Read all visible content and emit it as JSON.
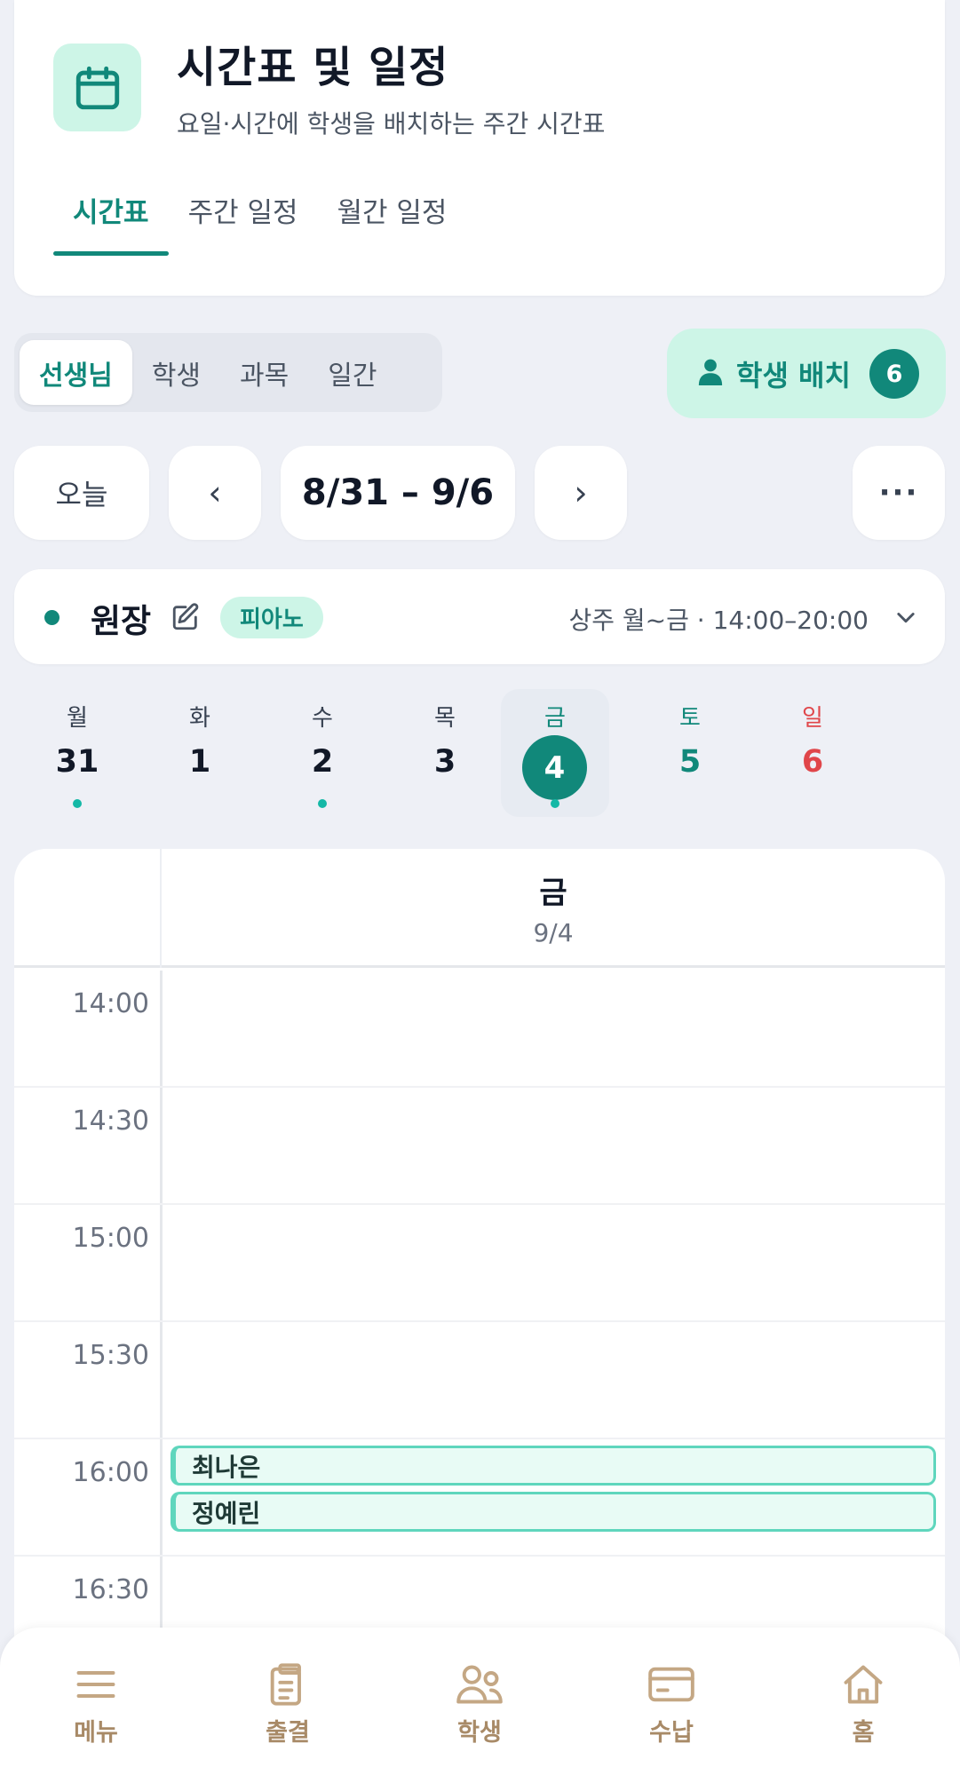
{
  "header": {
    "title": "시간표 및 일정",
    "subtitle": "요일·시간에 학생을 배치하는 주간 시간표",
    "tabs": [
      {
        "label": "시간표"
      },
      {
        "label": "주간 일정"
      },
      {
        "label": "월간 일정"
      }
    ]
  },
  "view_modes": [
    {
      "label": "선생님"
    },
    {
      "label": "학생"
    },
    {
      "label": "과목"
    },
    {
      "label": "일간"
    }
  ],
  "assign_button": {
    "label": "학생 배치",
    "count": "6"
  },
  "nav_controls": {
    "today": "오늘",
    "prev": "‹",
    "range": "8/31 – 9/6",
    "next": "›",
    "more": "···"
  },
  "teacher": {
    "name": "원장",
    "subject": "피아노",
    "schedule": "상주 월~금 · 14:00–20:00"
  },
  "week_days": [
    {
      "name": "월",
      "num": "31"
    },
    {
      "name": "화",
      "num": "1"
    },
    {
      "name": "수",
      "num": "2"
    },
    {
      "name": "목",
      "num": "3"
    },
    {
      "name": "금",
      "num": "4"
    },
    {
      "name": "토",
      "num": "5"
    },
    {
      "name": "일",
      "num": "6"
    }
  ],
  "day_view": {
    "day": "금",
    "date": "9/4",
    "slots": [
      "14:00",
      "14:30",
      "15:00",
      "15:30",
      "16:00",
      "16:30"
    ],
    "events": [
      {
        "student": "최나은"
      },
      {
        "student": "정예린"
      }
    ]
  },
  "bottom_nav": [
    {
      "label": "메뉴"
    },
    {
      "label": "출결"
    },
    {
      "label": "학생"
    },
    {
      "label": "수납"
    },
    {
      "label": "홈"
    }
  ],
  "colors": {
    "accent": "#11887a",
    "accent_soft": "#cdf5e7",
    "sunday": "#e0464a",
    "nav": "#a88a67"
  }
}
